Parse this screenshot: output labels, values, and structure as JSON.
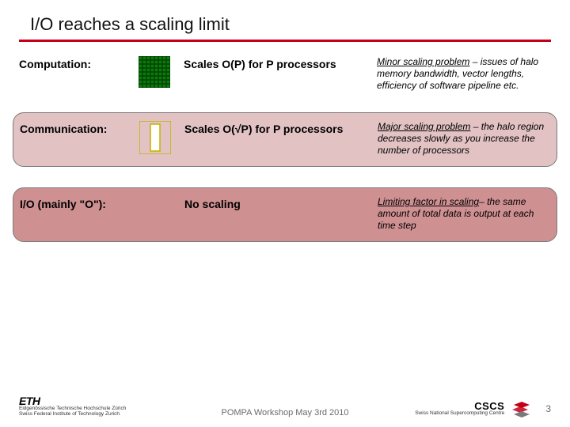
{
  "title": "I/O reaches a scaling limit",
  "rows": [
    {
      "label": "Computation:",
      "scaling": "Scales O(P) for P processors",
      "note_lead": "Minor scaling problem",
      "note_rest": " – issues of halo memory bandwidth, vector lengths, efficiency of software pipeline etc."
    },
    {
      "label": "Communication:",
      "scaling": "Scales O(√P) for P processors",
      "note_lead": "Major scaling problem",
      "note_rest": " – the halo region decreases slowly as you increase the number of processors"
    },
    {
      "label": "I/O (mainly \"O\"):",
      "scaling": "No scaling",
      "note_lead": "Limiting factor in scaling",
      "note_rest": "– the same amount of total data is output at each time step"
    }
  ],
  "footer": {
    "eth": "ETH",
    "eth_sub1": "Eidgenössische Technische Hochschule Zürich",
    "eth_sub2": "Swiss Federal Institute of Technology Zurich",
    "center": "POMPA Workshop May 3rd 2010",
    "cscs": "CSCS",
    "cscs_sub": "Swiss National Supercomputing Centre",
    "page": "3"
  }
}
